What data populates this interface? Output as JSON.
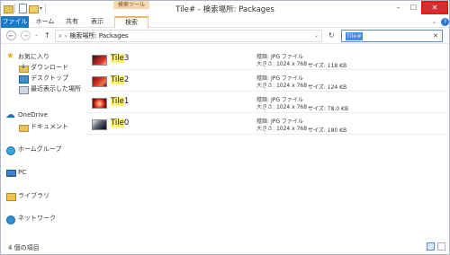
{
  "window": {
    "title": "Tile# - 検索場所: Packages",
    "context_tab_header": "検索ツール",
    "controls": {
      "minimize": "–",
      "maximize": "☐",
      "close": "✕"
    }
  },
  "ribbon": {
    "tabs": [
      "ファイル",
      "ホーム",
      "共有",
      "表示",
      "検索"
    ],
    "expand": "⌄",
    "help": "?"
  },
  "address_bar": {
    "back": "←",
    "forward": "→",
    "recent_dropdown": "⌄",
    "up": "↑",
    "search_glyph": "⌕",
    "chevron": "›",
    "path": "検索場所: Packages",
    "dropdown": "⌄",
    "refresh": "↻"
  },
  "search_box": {
    "value": "Tile#",
    "clear": "✕"
  },
  "nav_pane": {
    "favorites": {
      "label": "お気に入り",
      "items": [
        "ダウンロード",
        "デスクトップ",
        "最近表示した場所"
      ]
    },
    "onedrive": {
      "label": "OneDrive",
      "items": [
        "ドキュメント"
      ]
    },
    "homegroup": "ホームグループ",
    "pc": "PC",
    "libraries": "ライブラリ",
    "network": "ネットワーク"
  },
  "results": [
    {
      "prefix": "Tile",
      "suffix": "3",
      "type_label": "種類:",
      "type": "JPG ファイル",
      "dim_label": "大きさ:",
      "dimensions": "1024 x 768",
      "size_label": "サイズ:",
      "size": "118 KB"
    },
    {
      "prefix": "Tile",
      "suffix": "2",
      "type_label": "種類:",
      "type": "JPG ファイル",
      "dim_label": "大きさ:",
      "dimensions": "1024 x 768",
      "size_label": "サイズ:",
      "size": "124 KB"
    },
    {
      "prefix": "Tile",
      "suffix": "1",
      "type_label": "種類:",
      "type": "JPG ファイル",
      "dim_label": "大きさ:",
      "dimensions": "1024 x 768",
      "size_label": "サイズ:",
      "size": "78.0 KB"
    },
    {
      "prefix": "Tile",
      "suffix": "0",
      "type_label": "種類:",
      "type": "JPG ファイル",
      "dim_label": "大きさ:",
      "dimensions": "1024 x 768",
      "size_label": "サイズ:",
      "size": "180 KB"
    }
  ],
  "status_bar": {
    "item_count": "4 個の項目"
  },
  "colors": {
    "accent": "#1979ca",
    "close_button": "#d42f2f",
    "highlight": "#fff36b",
    "context_tab": "#f7d9b0"
  }
}
